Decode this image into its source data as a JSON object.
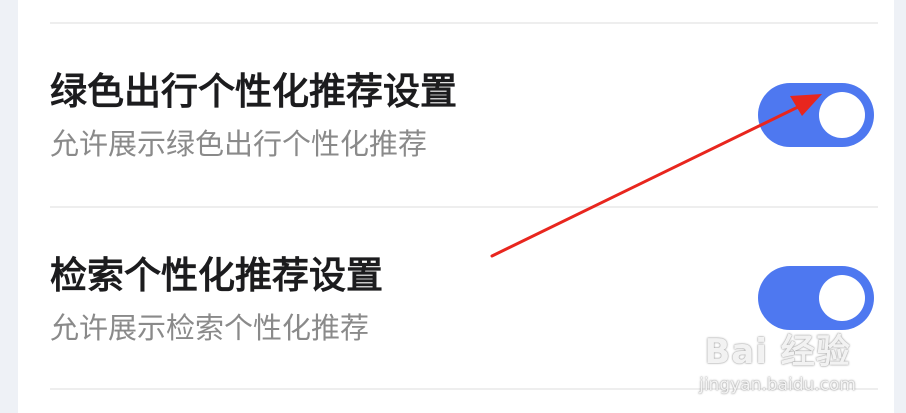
{
  "settings": {
    "items": [
      {
        "title": "绿色出行个性化推荐设置",
        "subtitle": "允许展示绿色出行个性化推荐",
        "enabled": true
      },
      {
        "title": "检索个性化推荐设置",
        "subtitle": "允许展示检索个性化推荐",
        "enabled": true
      }
    ]
  },
  "colors": {
    "toggle_on": "#4e78f0",
    "annotation_arrow": "#e8261e"
  },
  "watermark": {
    "main": "Bai 经验",
    "sub": "jingyan.baidu.com"
  }
}
